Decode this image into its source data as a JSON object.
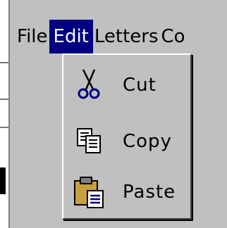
{
  "menubar": {
    "items": [
      {
        "label": "File"
      },
      {
        "label": "Edit"
      },
      {
        "label": "Letters"
      },
      {
        "label": "Co"
      }
    ]
  },
  "edit_menu": {
    "items": [
      {
        "label": "Cut",
        "icon": "scissors-icon"
      },
      {
        "label": "Copy",
        "icon": "copy-documents-icon"
      },
      {
        "label": "Paste",
        "icon": "clipboard-paste-icon"
      }
    ]
  },
  "colors": {
    "menu_background": "#c0c0c0",
    "highlight_background": "#000080",
    "highlight_text": "#ffffff",
    "icon_accent": "#000080",
    "clipboard_color": "#c8a040"
  }
}
